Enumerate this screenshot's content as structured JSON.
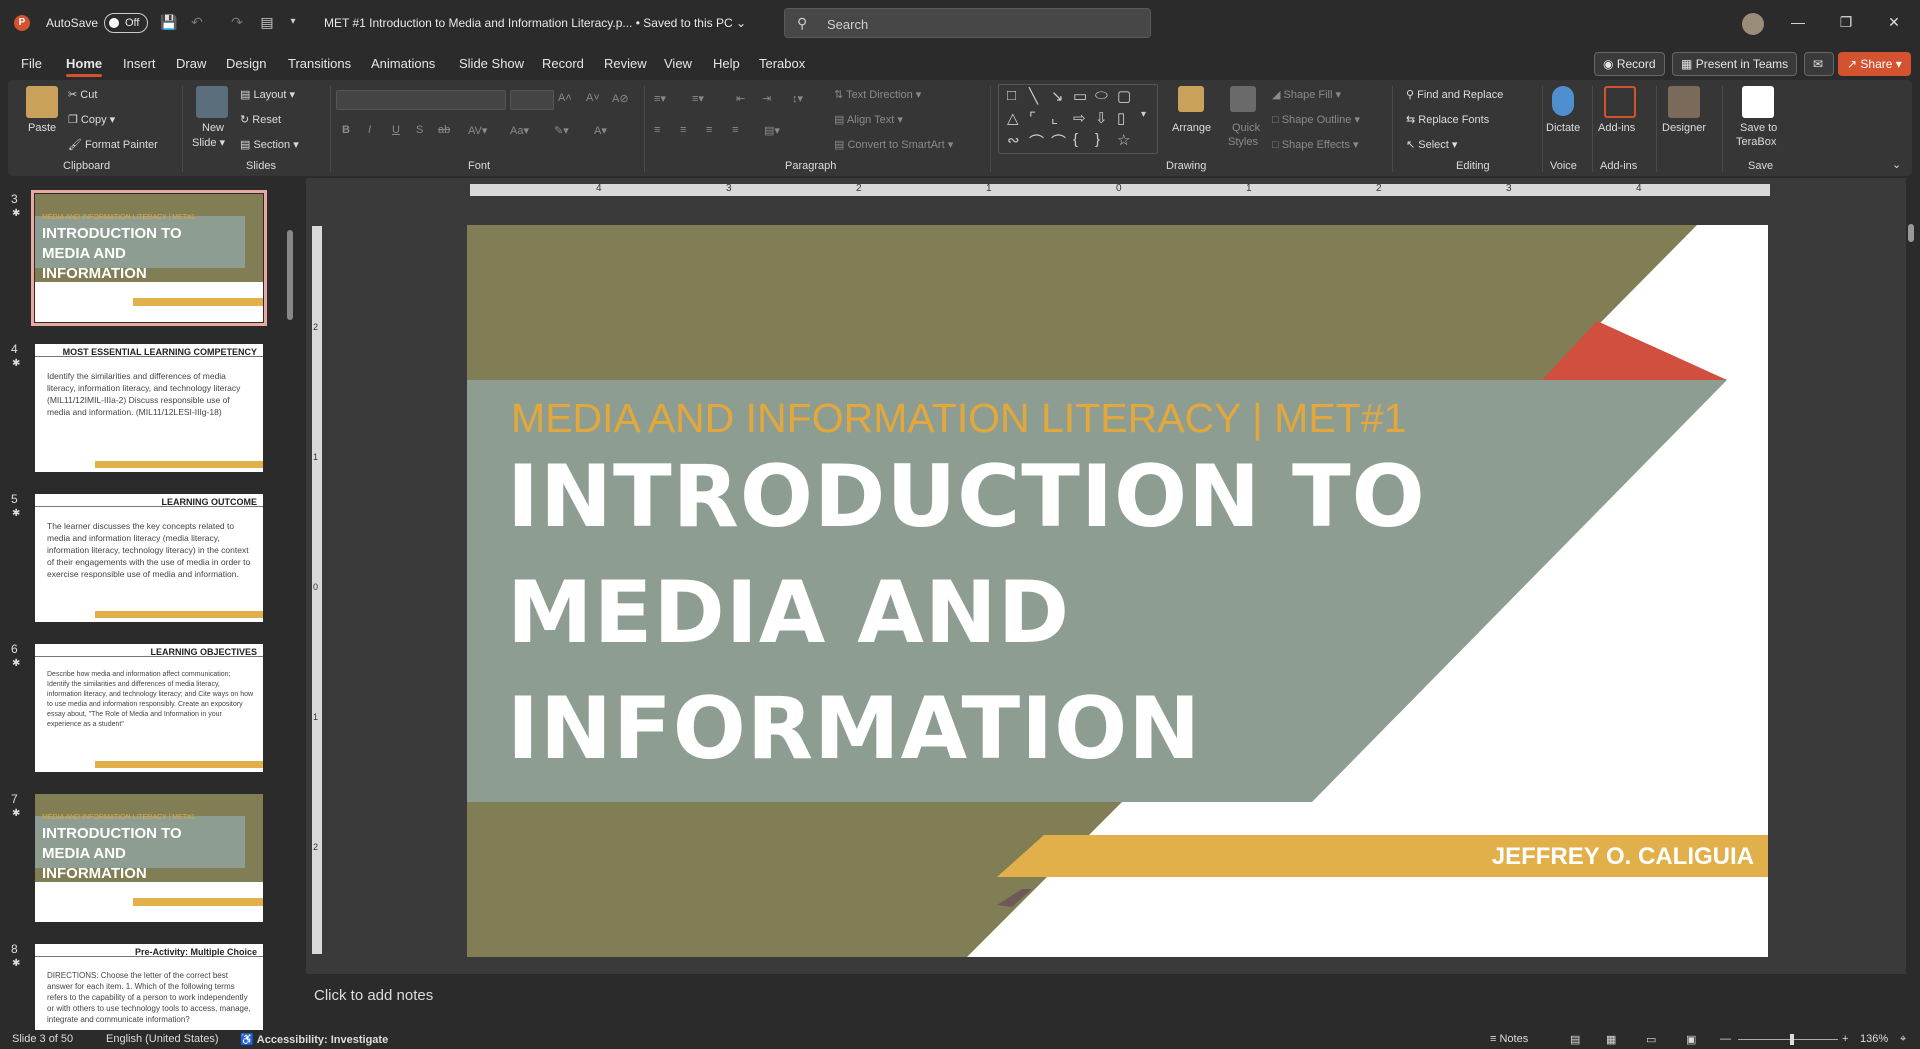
{
  "titlebar": {
    "app_letter": "P",
    "autosave_label": "AutoSave",
    "autosave_state": "Off",
    "doc_title": "MET #1 Introduction to Media and Information Literacy.p...",
    "saved_status": "• Saved to this PC",
    "search_placeholder": "Search"
  },
  "menu": {
    "items": [
      "File",
      "Home",
      "Insert",
      "Draw",
      "Design",
      "Transitions",
      "Animations",
      "Slide Show",
      "Record",
      "Review",
      "View",
      "Help",
      "Terabox"
    ],
    "active": "Home",
    "record_label": "Record",
    "present_label": "Present in Teams",
    "share_label": "Share"
  },
  "ribbon": {
    "clipboard": {
      "paste": "Paste",
      "cut": "Cut",
      "copy": "Copy",
      "format_painter": "Format Painter",
      "group": "Clipboard"
    },
    "slides": {
      "new_slide": "New",
      "new_slide2": "Slide",
      "layout": "Layout",
      "reset": "Reset",
      "section": "Section",
      "group": "Slides"
    },
    "font": {
      "group": "Font",
      "bold": "B",
      "italic": "I",
      "underline": "U",
      "shadow": "S",
      "strike": "ab"
    },
    "paragraph": {
      "text_direction": "Text Direction",
      "align_text": "Align Text",
      "convert_smartart": "Convert to SmartArt",
      "group": "Paragraph"
    },
    "drawing": {
      "arrange": "Arrange",
      "quick_styles": "Quick",
      "quick_styles2": "Styles",
      "shape_fill": "Shape Fill",
      "shape_outline": "Shape Outline",
      "shape_effects": "Shape Effects",
      "group": "Drawing"
    },
    "editing": {
      "find_replace": "Find and Replace",
      "replace_fonts": "Replace Fonts",
      "select": "Select",
      "group": "Editing"
    },
    "voice": {
      "dictate": "Dictate",
      "group": "Voice"
    },
    "addins": {
      "label": "Add-ins",
      "group": "Add-ins"
    },
    "designer": {
      "label": "Designer"
    },
    "save": {
      "label1": "Save to",
      "label2": "TeraBox",
      "group": "Save"
    }
  },
  "thumbnails": [
    {
      "num": "3",
      "kind": "title",
      "subtitle": "MEDIA AND INFORMATION LITERACY | MET#1",
      "lines": [
        "INTRODUCTION TO",
        "MEDIA AND",
        "INFORMATION"
      ],
      "author": "JEFFREY O. CALIGUIA"
    },
    {
      "num": "4",
      "kind": "text",
      "header": "MOST ESSENTIAL LEARNING COMPETENCY",
      "body": "Identify the similarities and differences of media literacy, information literacy, and technology literacy (MIL11/12IMIL-IIIa-2)  Discuss responsible use of media and information. (MIL11/12LESI-IIIg-18)"
    },
    {
      "num": "5",
      "kind": "text",
      "header": "LEARNING OUTCOME",
      "body": "The learner discusses the key concepts related to media and information literacy (media literacy, information literacy, technology literacy) in the context of their engagements with the use of media in order to exercise responsible use of media and information."
    },
    {
      "num": "6",
      "kind": "text",
      "header": "LEARNING OBJECTIVES",
      "body": "Describe how media and information affect communication; Identify the similarities and differences of media literacy, information literacy, and technology literacy; and Cite ways on how to use media and information responsibly. Create an expository essay about, \"The Role of Media and Information in your experience as a student\""
    },
    {
      "num": "7",
      "kind": "title",
      "subtitle": "MEDIA AND INFORMATION LITERACY | MET#1",
      "lines": [
        "INTRODUCTION TO",
        "MEDIA AND",
        "INFORMATION"
      ],
      "author": "JEFFREY O. CALIGUIA"
    },
    {
      "num": "8",
      "kind": "text",
      "header": "Pre-Activity: Multiple Choice",
      "body": "DIRECTIONS: Choose the letter of the correct best answer for each item. 1. Which of the following terms refers to the capability of a person to work independently or with others to use technology tools to access, manage, integrate and communicate information?"
    }
  ],
  "slide": {
    "subtitle": "MEDIA AND INFORMATION LITERACY | MET#1",
    "title_lines": [
      "INTRODUCTION TO",
      "MEDIA AND",
      "INFORMATION"
    ],
    "author": "JEFFREY O. CALIGUIA",
    "colors": {
      "olive": "#817e56",
      "sage": "#8e9d92",
      "red": "#d04f3e",
      "gold": "#e2b04a"
    }
  },
  "ruler": {
    "h_labels": [
      "4",
      "3",
      "2",
      "1",
      "0",
      "1",
      "2",
      "3",
      "4"
    ],
    "v_labels": [
      "2",
      "1",
      "0",
      "1",
      "2"
    ]
  },
  "notes_placeholder": "Click to add notes",
  "status": {
    "slide_info": "Slide 3 of 50",
    "language": "English (United States)",
    "accessibility": "Accessibility: Investigate",
    "notes": "Notes",
    "zoom": "136%"
  }
}
